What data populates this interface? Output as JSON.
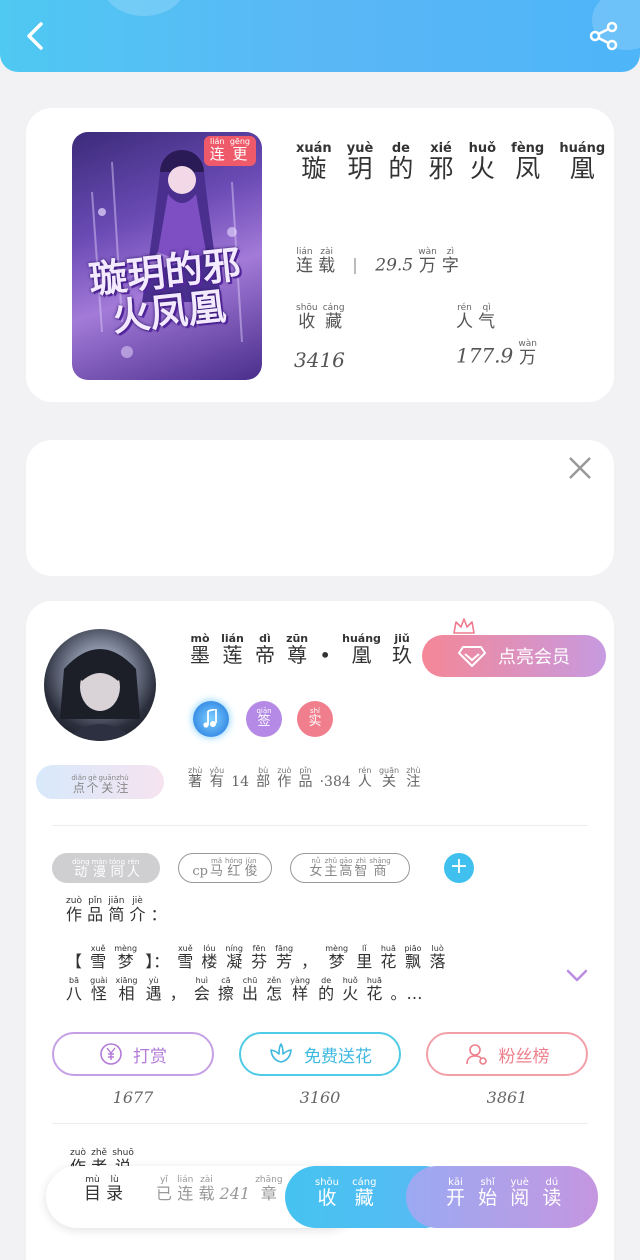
{
  "colors": {
    "header_blue": "#4fc8f2",
    "accent_pink": "#f48797",
    "accent_purple": "#c79ae0",
    "tag_red": "#ef5a6a",
    "cyan": "#3fc0ee"
  },
  "header": {
    "back_icon": "chevron-left-icon",
    "share_icon": "share-icon"
  },
  "book": {
    "cover_tag": {
      "py": [
        "lián",
        "gēng"
      ],
      "hz": [
        "连",
        "更"
      ]
    },
    "cover_title": "璇玥的邪火凤凰",
    "title": [
      {
        "py": "xuán",
        "hz": "璇"
      },
      {
        "py": "yuè",
        "hz": "玥"
      },
      {
        "py": "de",
        "hz": "的"
      },
      {
        "py": "xié",
        "hz": "邪"
      },
      {
        "py": "huǒ",
        "hz": "火"
      },
      {
        "py": "fèng",
        "hz": "凤"
      },
      {
        "py": "huáng",
        "hz": "凰"
      }
    ],
    "status": [
      {
        "py": "lián",
        "hz": "连"
      },
      {
        "py": "zài",
        "hz": "载"
      }
    ],
    "word_count_num": "29.5",
    "word_count_unit": [
      {
        "py": "wàn",
        "hz": "万"
      },
      {
        "py": "zì",
        "hz": "字"
      }
    ],
    "favorites_label": [
      {
        "py": "shōu",
        "hz": "收"
      },
      {
        "py": "cáng",
        "hz": "藏"
      }
    ],
    "popularity_label": [
      {
        "py": "rén",
        "hz": "人"
      },
      {
        "py": "qì",
        "hz": "气"
      }
    ],
    "favorites_value": "3416",
    "popularity_value": "177.9",
    "popularity_unit": {
      "py": "wàn",
      "hz": "万"
    }
  },
  "ad": {
    "close_icon": "close-icon"
  },
  "author": {
    "name": [
      {
        "py": "mò",
        "hz": "墨"
      },
      {
        "py": "lián",
        "hz": "莲"
      },
      {
        "py": "dì",
        "hz": "帝"
      },
      {
        "py": "zūn",
        "hz": "尊"
      },
      {
        "py": "",
        "hz": "•"
      },
      {
        "py": "huáng",
        "hz": "凰"
      },
      {
        "py": "jiǔ",
        "hz": "玖"
      }
    ],
    "name_ellipsis": "…",
    "vip_button": "点亮会员",
    "badges": [
      {
        "icon": "music-note-icon",
        "py": "",
        "hz": ""
      },
      {
        "icon": "sign-badge",
        "py": "qiān",
        "hz": "签"
      },
      {
        "icon": "real-badge",
        "py": "shí",
        "hz": "实"
      }
    ],
    "follow_button": [
      {
        "py": "diǎn",
        "hz": "点"
      },
      {
        "py": "gè",
        "hz": "个"
      },
      {
        "py": "guān",
        "hz": "关"
      },
      {
        "py": "zhù",
        "hz": "注"
      }
    ],
    "works_line": [
      {
        "py": "zhù",
        "hz": "著"
      },
      {
        "py": "yǒu",
        "hz": "有"
      },
      {
        "py": "",
        "hz": "14"
      },
      {
        "py": "bù",
        "hz": "部"
      },
      {
        "py": "zuò",
        "hz": "作"
      },
      {
        "py": "pǐn",
        "hz": "品"
      },
      {
        "py": "",
        "hz": "·384"
      },
      {
        "py": "rén",
        "hz": "人"
      },
      {
        "py": "guān",
        "hz": "关"
      },
      {
        "py": "zhù",
        "hz": "注"
      }
    ]
  },
  "tags": [
    {
      "label": [
        {
          "py": "dòng",
          "hz": "动"
        },
        {
          "py": "màn",
          "hz": "漫"
        },
        {
          "py": "tóng",
          "hz": "同"
        },
        {
          "py": "rén",
          "hz": "人"
        }
      ]
    },
    {
      "label": [
        {
          "py": "",
          "hz": "cp"
        },
        {
          "py": "mǎ",
          "hz": "马"
        },
        {
          "py": "hóng",
          "hz": "红"
        },
        {
          "py": "jùn",
          "hz": "俊"
        }
      ]
    },
    {
      "label": [
        {
          "py": "nǚ",
          "hz": "女"
        },
        {
          "py": "zhǔ",
          "hz": "主"
        },
        {
          "py": "gāo",
          "hz": "高"
        },
        {
          "py": "zhì",
          "hz": "智"
        },
        {
          "py": "shāng",
          "hz": "商"
        }
      ]
    }
  ],
  "intro": {
    "label": [
      {
        "py": "zuò",
        "hz": "作"
      },
      {
        "py": "pǐn",
        "hz": "品"
      },
      {
        "py": "jiǎn",
        "hz": "简"
      },
      {
        "py": "jiè",
        "hz": "介"
      },
      {
        "py": "",
        "hz": "："
      }
    ],
    "line1": [
      {
        "py": "",
        "hz": "【"
      },
      {
        "py": "xuě",
        "hz": "雪"
      },
      {
        "py": "mèng",
        "hz": "梦"
      },
      {
        "py": "",
        "hz": "】："
      },
      {
        "py": "xuě",
        "hz": "雪"
      },
      {
        "py": "lóu",
        "hz": "楼"
      },
      {
        "py": "níng",
        "hz": "凝"
      },
      {
        "py": "fēn",
        "hz": "芬"
      },
      {
        "py": "fāng",
        "hz": "芳"
      },
      {
        "py": "",
        "hz": "，"
      },
      {
        "py": "mèng",
        "hz": "梦"
      },
      {
        "py": "lǐ",
        "hz": "里"
      },
      {
        "py": "huā",
        "hz": "花"
      },
      {
        "py": "piāo",
        "hz": "飘"
      },
      {
        "py": "luò",
        "hz": "落"
      }
    ],
    "line2": [
      {
        "py": "bā",
        "hz": "八"
      },
      {
        "py": "guài",
        "hz": "怪"
      },
      {
        "py": "xiāng",
        "hz": "相"
      },
      {
        "py": "yù",
        "hz": "遇"
      },
      {
        "py": "",
        "hz": "，"
      },
      {
        "py": "huì",
        "hz": "会"
      },
      {
        "py": "cā",
        "hz": "擦"
      },
      {
        "py": "chū",
        "hz": "出"
      },
      {
        "py": "zěn",
        "hz": "怎"
      },
      {
        "py": "yàng",
        "hz": "样"
      },
      {
        "py": "de",
        "hz": "的"
      },
      {
        "py": "huǒ",
        "hz": "火"
      },
      {
        "py": "huā",
        "hz": "花"
      },
      {
        "py": "",
        "hz": "。…"
      }
    ]
  },
  "actions": [
    {
      "label": "打赏",
      "count": "1677",
      "icon": "yen-coin-icon",
      "color": "#c6a0e6",
      "text_color": "#b37ad8"
    },
    {
      "label": "免费送花",
      "count": "3160",
      "icon": "flower-icon",
      "color": "#4fcbe6",
      "text_color": "#3fb9e0"
    },
    {
      "label": "粉丝榜",
      "count": "3861",
      "icon": "user-rank-icon",
      "color": "#f2a0a8",
      "text_color": "#ee7f8c"
    }
  ],
  "catalog_hint": [
    {
      "py": "zuò",
      "hz": "作"
    },
    {
      "py": "zhě",
      "hz": "者"
    },
    {
      "py": "shuō",
      "hz": "说"
    }
  ],
  "bottom_bar": {
    "catalog": [
      {
        "py": "mù",
        "hz": "目"
      },
      {
        "py": "lù",
        "hz": "录"
      }
    ],
    "chapters": [
      {
        "py": "yǐ",
        "hz": "已"
      },
      {
        "py": "lián",
        "hz": "连"
      },
      {
        "py": "zài",
        "hz": "载"
      },
      {
        "py": "",
        "hz": "241"
      },
      {
        "py": "zhāng",
        "hz": "章"
      }
    ],
    "favorite": [
      {
        "py": "shōu",
        "hz": "收"
      },
      {
        "py": "cáng",
        "hz": "藏"
      }
    ],
    "read": [
      {
        "py": "kāi",
        "hz": "开"
      },
      {
        "py": "shǐ",
        "hz": "始"
      },
      {
        "py": "yuè",
        "hz": "阅"
      },
      {
        "py": "dú",
        "hz": "读"
      }
    ]
  }
}
